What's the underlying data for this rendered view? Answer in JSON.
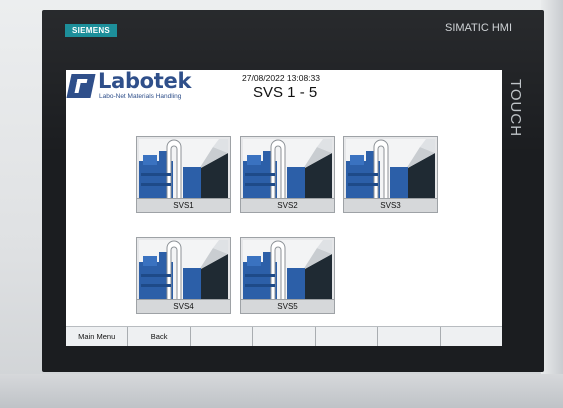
{
  "device": {
    "brand": "SIEMENS",
    "model": "SIMATIC HMI",
    "touch_label": "TOUCH"
  },
  "header": {
    "logo_name": "Labotek",
    "logo_tagline": "Labo-Net Materials Handling",
    "datetime": "27/08/2022 13:08:33",
    "title": "SVS 1 - 5"
  },
  "tiles": [
    {
      "label": "SVS1",
      "icon": "dryer-machine-icon"
    },
    {
      "label": "SVS2",
      "icon": "dryer-machine-icon"
    },
    {
      "label": "SVS3",
      "icon": "dryer-machine-icon"
    },
    {
      "label": "SVS4",
      "icon": "dryer-machine-icon"
    },
    {
      "label": "SVS5",
      "icon": "dryer-machine-icon"
    }
  ],
  "softkeys": [
    "Main Menu",
    "Back",
    "",
    "",
    "",
    "",
    ""
  ],
  "colors": {
    "brand_teal": "#1d8f9a",
    "logo_blue": "#2f4f8a",
    "machine_blue": "#2c5fa8",
    "bezel": "#1b1d20"
  }
}
